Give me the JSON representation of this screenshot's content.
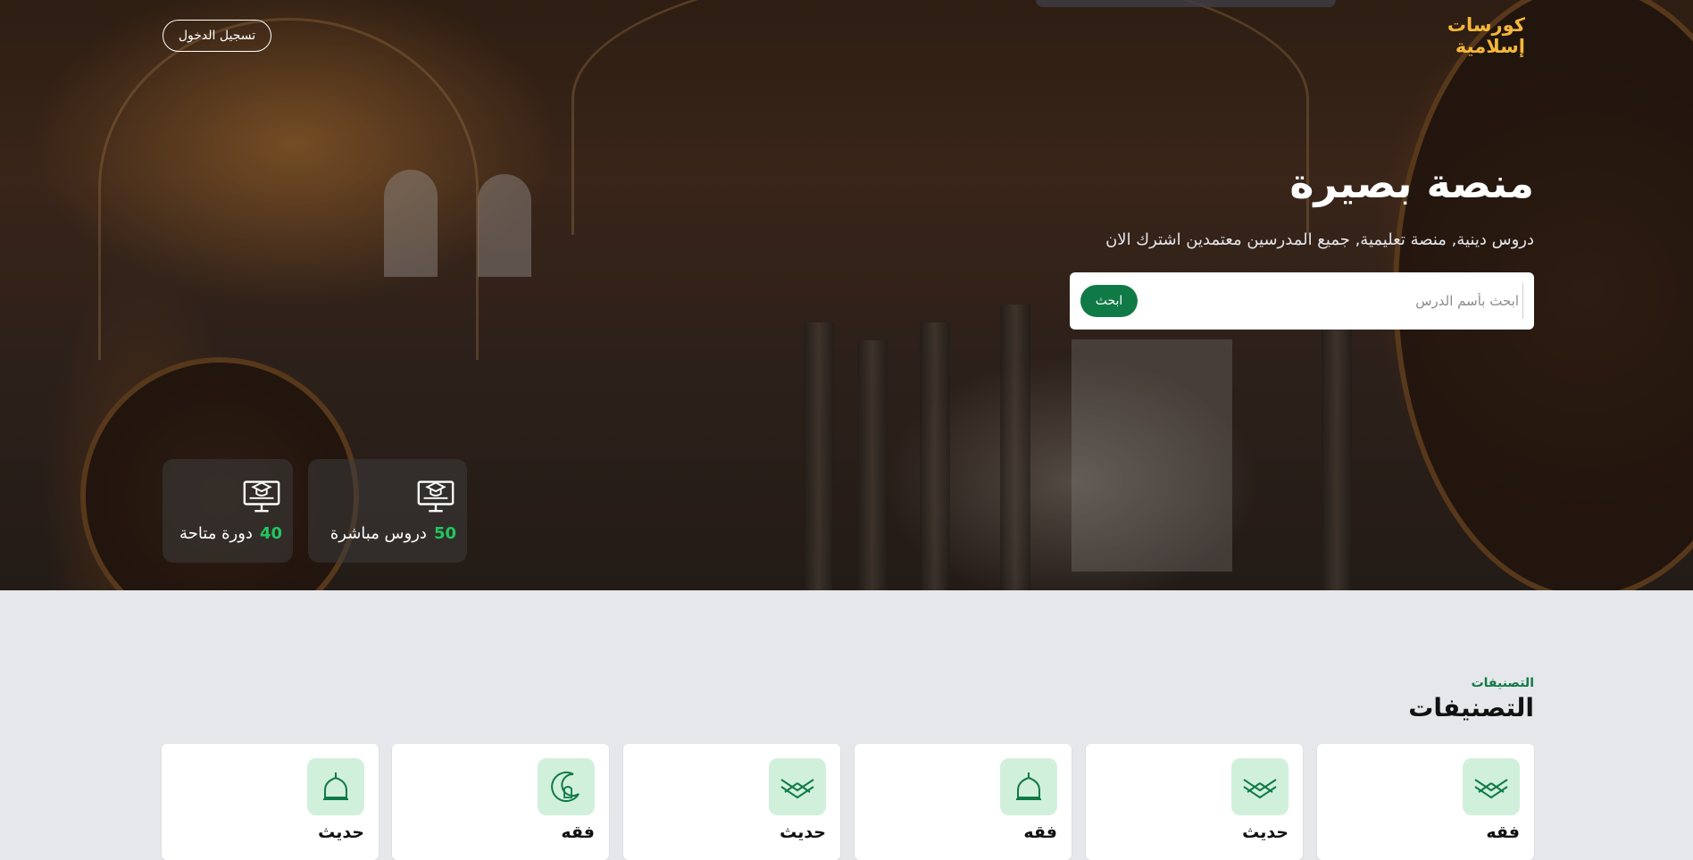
{
  "header": {
    "brand_line1": "كورسات",
    "brand_line2": "إسلامية",
    "login_label": "تسجيل الدخول"
  },
  "hero": {
    "title": "منصة بصيرة",
    "subtitle": "دروس دينية, منصة تعليمية, جميع المدرسين معتمدين اشترك الان",
    "search": {
      "placeholder": "ابحث بأسم الدرس",
      "button_label": "ابحث"
    },
    "stats": [
      {
        "number": "50",
        "label": "دروس مباشرة",
        "icon": "monitor-graduation-icon"
      },
      {
        "number": "40",
        "label": "دورة متاحة",
        "icon": "monitor-graduation-icon"
      }
    ]
  },
  "categories": {
    "eyebrow": "التصنيفات",
    "title": "التصنيفات",
    "items": [
      {
        "label": "فقه",
        "icon": "open-quran-icon"
      },
      {
        "label": "حديث",
        "icon": "open-quran-icon"
      },
      {
        "label": "فقه",
        "icon": "mosque-dome-icon"
      },
      {
        "label": "حديث",
        "icon": "open-quran-icon"
      },
      {
        "label": "فقه",
        "icon": "crescent-mosque-icon"
      },
      {
        "label": "حديث",
        "icon": "mosque-dome-icon"
      }
    ]
  },
  "colors": {
    "accent_green": "#0f7a45",
    "stat_number_green": "#22c55e",
    "brand_gold": "#f5b73b",
    "icon_bg": "#d1f0dc",
    "page_bg": "#e5e7eb"
  }
}
